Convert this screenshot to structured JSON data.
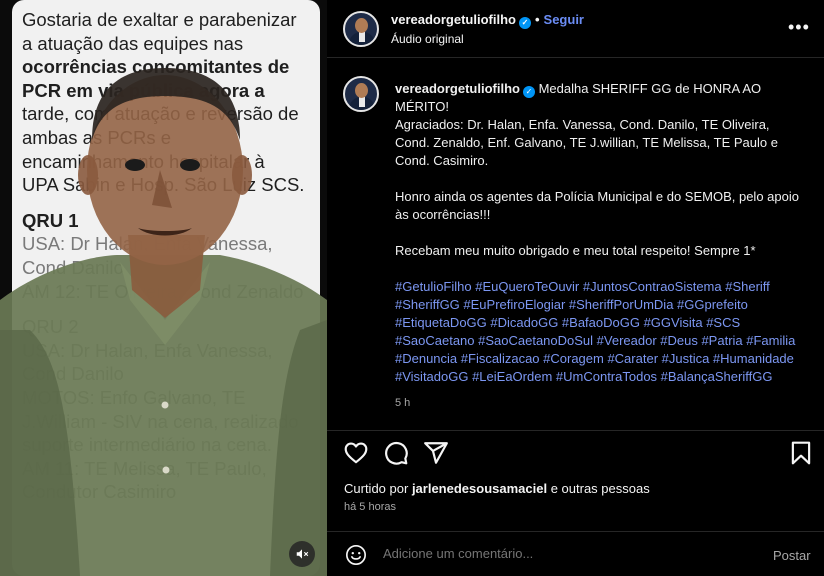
{
  "media": {
    "note_lines": [
      {
        "text": "Gostaria de exaltar e parabenizar",
        "style": ""
      },
      {
        "text": "a atuação das equipes nas",
        "style": ""
      },
      {
        "text": "ocorrências concomitantes de",
        "style": "b"
      },
      {
        "text": "PCR em via pública agora a",
        "style": "b"
      },
      {
        "text": "tarde, com atuação e reversão de",
        "style": ""
      },
      {
        "text": "ambas as PCRs e",
        "style": ""
      },
      {
        "text": "encaminhamento hospitalar à",
        "style": ""
      },
      {
        "text": "UPA Sabin e Hosp. São Luiz SCS.",
        "style": ""
      },
      {
        "text": "",
        "style": "gap"
      },
      {
        "text": "QRU 1",
        "style": "b"
      },
      {
        "text": "USA: Dr Halan, Enfa Vanessa,",
        "style": "fade"
      },
      {
        "text": "Cond Danilo",
        "style": "fade"
      },
      {
        "text": "AM 12: TE Oliveira, Cond Zenaldo",
        "style": "fade"
      },
      {
        "text": "",
        "style": "gap"
      },
      {
        "text": "QRU 2",
        "style": "fade"
      },
      {
        "text": "USA: Dr Halan, Enfa Vanessa,",
        "style": "fade"
      },
      {
        "text": "Cond Danilo",
        "style": "fade"
      },
      {
        "text": "MOTOS: Enfo Galvano, TE",
        "style": "fade"
      },
      {
        "text": "J.William - SIV na cena, realizado",
        "style": "fade"
      },
      {
        "text": "suporte intermediário na cena.",
        "style": "fade"
      },
      {
        "text": "AM 11: TE Melissa, TE Paulo,",
        "style": "fade"
      },
      {
        "text": "Condutor Casimiro",
        "style": "fade"
      }
    ],
    "mute_icon": "speaker-muted-icon"
  },
  "header": {
    "username": "vereadorgetuliofilho",
    "separator": "•",
    "follow_label": "Seguir",
    "audio_label": "Áudio original",
    "more_icon": "more-horizontal-icon"
  },
  "caption": {
    "username": "vereadorgetuliofilho",
    "title": "Medalha SHERIFF GG de HONRA AO MÉRITO!",
    "awardees": "Agraciados: Dr. Halan, Enfa. Vanessa, Cond. Danilo, TE Oliveira, Cond. Zenaldo, Enf. Galvano, TE J.willian, TE Melissa, TE Paulo e Cond. Casimiro.",
    "honor": "Honro ainda os agentes da Polícia Municipal e do SEMOB, pelo apoio às ocorrências!!!",
    "thanks": "Recebam meu muito obrigado e meu total respeito! Sempre 1*",
    "hashtags": "#GetulioFilho #EuQueroTeOuvir #JuntosContraoSistema #Sheriff #SheriffGG #EuPrefiroElogiar #SheriffPorUmDia #GGprefeito #EtiquetaDoGG #DicadoGG #BafaoDoGG #GGVisita #SCS #SaoCaetano #SaoCaetanoDoSul #Vereador #Deus #Patria #Familia #Denuncia #Fiscalizacao #Coragem #Carater #Justica #Humanidade #VisitadoGG #LeiEaOrdem #UmContraTodos #BalançaSheriffGG",
    "time": "5 h"
  },
  "actions": {
    "like_icon": "heart-icon",
    "comment_icon": "comment-icon",
    "share_icon": "paper-plane-icon",
    "save_icon": "bookmark-icon"
  },
  "likes": {
    "prefix": "Curtido por",
    "user": "jarlenedesousamaciel",
    "suffix": "e outras pessoas"
  },
  "posted_ago": "há 5 horas",
  "comment": {
    "emoji_icon": "emoji-icon",
    "placeholder": "Adicione um comentário...",
    "post_label": "Postar"
  },
  "colors": {
    "link_blue": "#7c97f2",
    "follow_blue": "#6b8df5",
    "verified_blue": "#0095f6",
    "background": "#000000"
  }
}
